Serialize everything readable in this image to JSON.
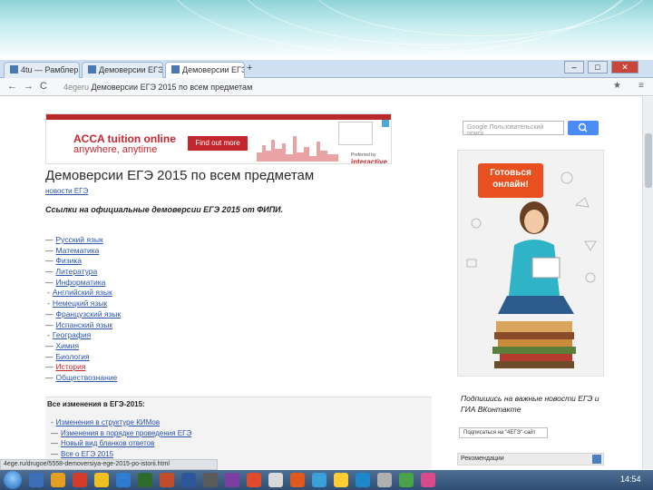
{
  "tabs": [
    {
      "label": "4tu — Рамблер"
    },
    {
      "label": "Демоверсии ЕГЭ"
    },
    {
      "label": "Демоверсии ЕГЭ"
    }
  ],
  "window_controls": {
    "minimize": "–",
    "maximize": "□",
    "close": "✕"
  },
  "nav": {
    "back": "←",
    "forward": "→",
    "reload": "C",
    "url_prefix": "4egeru",
    "url": "Демоверсии ЕГЭ 2015 по всем предметам",
    "star": "★",
    "menu": "≡",
    "new_tab": "+"
  },
  "ad": {
    "title": "ACCA tuition online",
    "tagline": "anywhere, anytime",
    "button": "Find out more",
    "brand": "interactive",
    "brand_pre": "Preferred by"
  },
  "page": {
    "title": "Демоверсии ЕГЭ 2015 по всем предметам",
    "breadcrumb": "новости ЕГЭ",
    "lead": "Ссылки на официальные демоверсии ЕГЭ 2015 от ФИПИ."
  },
  "subjects": [
    {
      "label": "Русский язык",
      "dash": "—",
      "style": ""
    },
    {
      "label": "Математика",
      "dash": "—",
      "style": ""
    },
    {
      "label": "Физика",
      "dash": "—",
      "style": ""
    },
    {
      "label": "Литература",
      "dash": "—",
      "style": ""
    },
    {
      "label": "Информатика",
      "dash": "—",
      "style": ""
    },
    {
      "label": "Английский язык",
      "dash": "-",
      "style": "sub"
    },
    {
      "label": "Немецкий язык",
      "dash": "-",
      "style": "sub"
    },
    {
      "label": "Французский язык",
      "dash": "—",
      "style": ""
    },
    {
      "label": "Испанский язык",
      "dash": "—",
      "style": ""
    },
    {
      "label": "География",
      "dash": "-",
      "style": "sub"
    },
    {
      "label": "Химия",
      "dash": "—",
      "style": ""
    },
    {
      "label": "Биология",
      "dash": "—",
      "style": ""
    },
    {
      "label": "История",
      "dash": "—",
      "style": "red"
    },
    {
      "label": "Обществознание",
      "dash": "—",
      "style": ""
    }
  ],
  "changes": {
    "heading": "Все изменения в ЕГЭ-2015:",
    "items": [
      {
        "dash": "-",
        "label": "Изменения в структуре КИМов"
      },
      {
        "dash": "—",
        "label": "Изменения в порядке проведения ЕГЭ"
      },
      {
        "dash": "—",
        "label": "Новый вид бланков ответов"
      },
      {
        "dash": "—",
        "label": "Все о ЕГЭ 2015"
      }
    ]
  },
  "sidebar": {
    "search_placeholder": "Google Пользовательский поиск",
    "promo_badge": "Готовься онлайн!",
    "vk_text": "Подпишись на важные новости ЕГЭ и ГИА ВКонтакте",
    "vk_button": "Подписаться на \"4ЕГЭ\"-сайт",
    "recommend": "Рекомендации"
  },
  "status_url": "4ege.ru/drugoe/5558-demoversiya-ege-2015-po-istorii.html",
  "clock": "14:54",
  "colors": {
    "link": "#2a54a8",
    "ad_red": "#c4262e",
    "taskbar": "#2f4d72"
  }
}
